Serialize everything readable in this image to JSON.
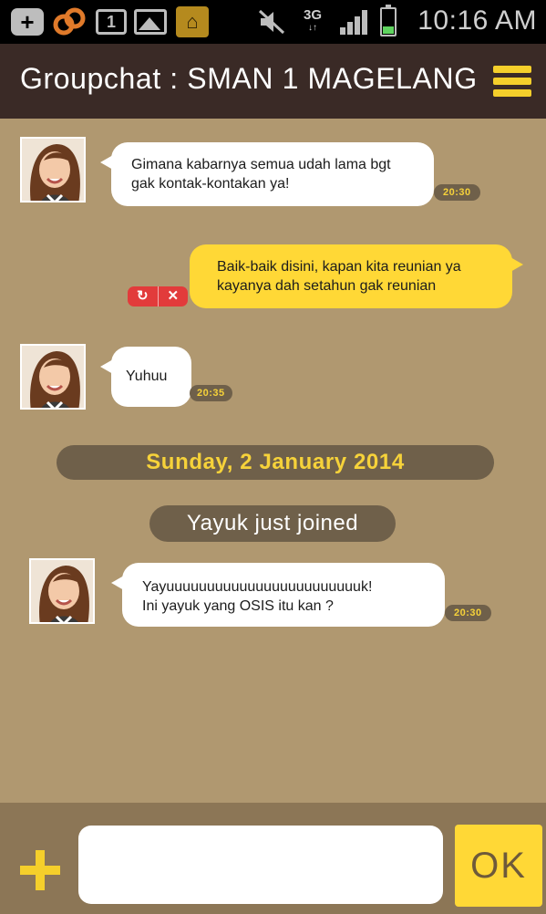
{
  "status_bar": {
    "time": "10:16 AM",
    "network": "3G",
    "network_arrows": "↓↑",
    "calendar_day": "1",
    "icons": [
      "plus-badge-icon",
      "link-icon",
      "calendar-icon",
      "image-icon",
      "house-icon",
      "mute-icon",
      "network-3g-icon",
      "signal-icon",
      "battery-icon"
    ]
  },
  "header": {
    "title": "Groupchat : SMAN 1 MAGELANG",
    "menu_icon": "hamburger-menu-icon"
  },
  "messages": [
    {
      "sender": "incoming",
      "text": "Gimana kabarnya semua udah lama bgt\ngak kontak-kontakan ya!",
      "time": "20:30"
    },
    {
      "sender": "outgoing",
      "text": "Baik-baik disini, kapan kita reunian ya\nkayanya dah setahun gak reunian",
      "status_actions": [
        "↻",
        "✕"
      ]
    },
    {
      "sender": "incoming",
      "text": "Yuhuu",
      "time": "20:35"
    },
    {
      "sender": "incoming",
      "text": "Yayuuuuuuuuuuuuuuuuuuuuuuuuk!\nIni yayuk yang OSIS itu kan ?",
      "time": "20:30"
    }
  ],
  "date_separator": "Sunday, 2 January 2014",
  "system_notice": "Yayuk just joined",
  "composer": {
    "placeholder": "",
    "send_label": "OK",
    "add_icon": "plus-icon"
  },
  "colors": {
    "header_bg": "#3a2a26",
    "chat_bg": "#b09870",
    "accent_yellow": "#ffd836",
    "pill_bg": "#6f604a",
    "input_bar_bg": "#8c7656",
    "error_red": "#e23b3b"
  }
}
